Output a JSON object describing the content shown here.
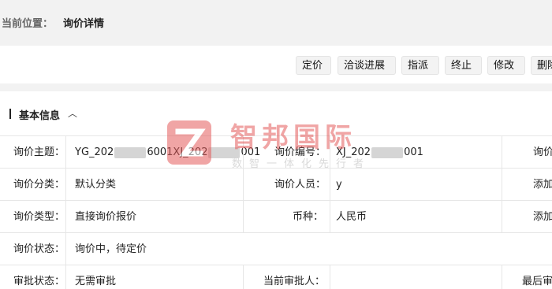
{
  "breadcrumb": {
    "prefix": "当前位置：",
    "current": "询价详情"
  },
  "toolbar": {
    "buttons": [
      "定价",
      "洽谈进展",
      "指派",
      "终止",
      "修改",
      "删除"
    ]
  },
  "section": {
    "title": "基本信息",
    "chevron": "︿"
  },
  "table": {
    "rows": [
      {
        "l1": "询价主题：",
        "v1a": "YG_202",
        "v1b": "6001XJ_202",
        "v1c": "001",
        "l2": "询价编号：",
        "v2a": "XJ_202",
        "v2b": "001",
        "l3": "询价"
      },
      {
        "l1": "询价分类：",
        "v1": "默认分类",
        "l2": "询价人员：",
        "v2": "y",
        "l3": "添加"
      },
      {
        "l1": "询价类型：",
        "v1": "直接询价报价",
        "l2": "币种：",
        "v2": "人民币",
        "l3": "添加"
      },
      {
        "l1": "询价状态：",
        "v1": "询价中，待定价"
      },
      {
        "l1": "审批状态：",
        "v1": "无需审批",
        "l2": "当前审批人：",
        "l3": "最后审"
      }
    ]
  },
  "watermark": {
    "name": "智邦国际",
    "slogan": "数智一体化先行者",
    "brand_color": "#e45c5c"
  },
  "colors": {
    "page_bg": "#f2f2f2",
    "card_bg": "#ffffff",
    "border": "#e6e6e6",
    "button_bg": "#f3f3f3"
  }
}
